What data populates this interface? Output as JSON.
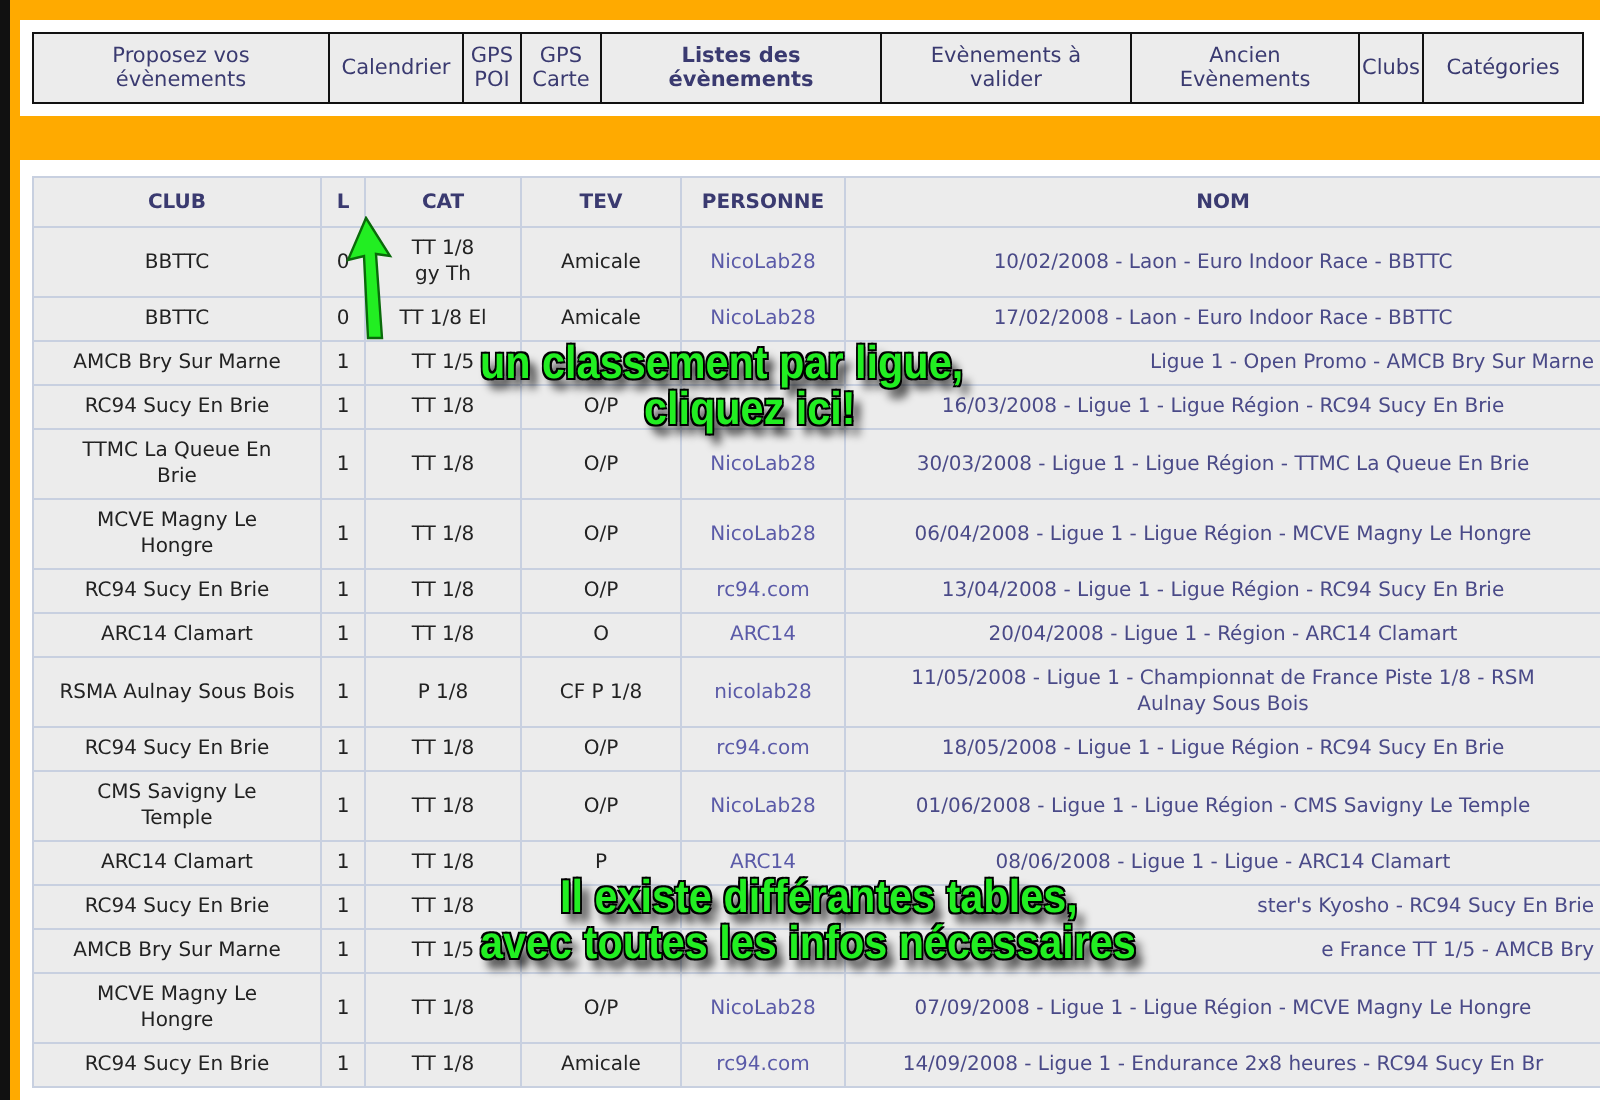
{
  "nav": [
    {
      "label": "Proposez vos évènements",
      "selected": false
    },
    {
      "label": "Calendrier",
      "selected": false
    },
    {
      "label": "GPS POI",
      "selected": false
    },
    {
      "label": "GPS Carte",
      "selected": false
    },
    {
      "label": "Listes des évènements",
      "selected": true
    },
    {
      "label": "Evènements à valider",
      "selected": false
    },
    {
      "label": "Ancien Evènements",
      "selected": false
    },
    {
      "label": "Clubs",
      "selected": false
    },
    {
      "label": "Catégories",
      "selected": false
    }
  ],
  "table": {
    "columns": [
      "CLUB",
      "L",
      "CAT",
      "TEV",
      "PERSONNE",
      "NOM"
    ],
    "rows": [
      {
        "kind": "full",
        "club": "BBTTC",
        "l": "0",
        "cat": "TT 1/8\ngy Th",
        "tev": "Amicale",
        "personne": "NicoLab28",
        "nom": "10/02/2008 - Laon - Euro Indoor Race - BBTTC"
      },
      {
        "kind": "full",
        "club": "BBTTC",
        "l": "0",
        "cat": "TT 1/8 El",
        "tev": "Amicale",
        "personne": "NicoLab28",
        "nom": "17/02/2008 - Laon - Euro Indoor Race - BBTTC"
      },
      {
        "kind": "covered",
        "club": "AMCB Bry Sur Marne",
        "l": "1",
        "cat": "TT 1/5",
        "nom": "Ligue 1 - Open Promo - AMCB Bry Sur Marne"
      },
      {
        "kind": "full",
        "club": "RC94 Sucy En Brie",
        "l": "1",
        "cat": "TT 1/8",
        "tev": "O/P",
        "nom": "16/03/2008 - Ligue 1 - Ligue Région - RC94 Sucy En Brie"
      },
      {
        "kind": "full",
        "club": "TTMC La Queue En\nBrie",
        "l": "1",
        "cat": "TT 1/8",
        "tev": "O/P",
        "personne": "NicoLab28",
        "nom": "30/03/2008 - Ligue 1 - Ligue Région - TTMC La Queue En Brie"
      },
      {
        "kind": "full",
        "club": "MCVE Magny Le\nHongre",
        "l": "1",
        "cat": "TT 1/8",
        "tev": "O/P",
        "personne": "NicoLab28",
        "nom": "06/04/2008 - Ligue 1 - Ligue Région - MCVE Magny Le Hongre"
      },
      {
        "kind": "full",
        "club": "RC94 Sucy En Brie",
        "l": "1",
        "cat": "TT 1/8",
        "tev": "O/P",
        "personne": "rc94.com",
        "nom": "13/04/2008 - Ligue 1 - Ligue Région - RC94 Sucy En Brie"
      },
      {
        "kind": "full",
        "club": "ARC14 Clamart",
        "l": "1",
        "cat": "TT 1/8",
        "tev": "O",
        "personne": "ARC14",
        "nom": "20/04/2008 - Ligue 1 - Région - ARC14 Clamart"
      },
      {
        "kind": "full",
        "club": "RSMA Aulnay Sous Bois",
        "l": "1",
        "cat": "P 1/8",
        "tev": "CF P 1/8",
        "personne": "nicolab28",
        "nom": "11/05/2008 - Ligue 1 - Championnat de France Piste 1/8 - RSM\nAulnay Sous Bois"
      },
      {
        "kind": "full",
        "club": "RC94 Sucy En Brie",
        "l": "1",
        "cat": "TT 1/8",
        "tev": "O/P",
        "personne": "rc94.com",
        "nom": "18/05/2008 - Ligue 1 - Ligue Région - RC94 Sucy En Brie"
      },
      {
        "kind": "full",
        "club": "CMS Savigny Le\nTemple",
        "l": "1",
        "cat": "TT 1/8",
        "tev": "O/P",
        "personne": "NicoLab28",
        "nom": "01/06/2008 - Ligue 1 - Ligue Région - CMS Savigny Le Temple"
      },
      {
        "kind": "full",
        "club": "ARC14 Clamart",
        "l": "1",
        "cat": "TT 1/8",
        "tev": "P",
        "personne": "ARC14",
        "nom": "08/06/2008 - Ligue 1 - Ligue - ARC14 Clamart"
      },
      {
        "kind": "covered",
        "club": "RC94 Sucy En Brie",
        "l": "1",
        "cat": "TT 1/8",
        "nom": "ster's Kyosho - RC94 Sucy En Brie"
      },
      {
        "kind": "covered",
        "club": "AMCB Bry Sur Marne",
        "l": "1",
        "cat": "TT 1/5",
        "nom": "e France TT 1/5 - AMCB Bry"
      },
      {
        "kind": "full",
        "club": "MCVE Magny Le\nHongre",
        "l": "1",
        "cat": "TT 1/8",
        "tev": "O/P",
        "personne": "NicoLab28",
        "nom": "07/09/2008 - Ligue 1 - Ligue Région - MCVE Magny Le Hongre"
      },
      {
        "kind": "full",
        "club": "RC94 Sucy En Brie",
        "l": "1",
        "cat": "TT 1/8",
        "tev": "Amicale",
        "personne": "rc94.com",
        "nom": "14/09/2008 - Ligue 1 - Endurance 2x8 heures - RC94 Sucy En Br"
      }
    ]
  },
  "annotations": [
    {
      "lines": [
        "un classement par ligue,",
        "cliquez ici!"
      ]
    },
    {
      "lines": [
        "Il existe différantes tables,",
        "avec toutes les infos nécessaires"
      ]
    }
  ]
}
